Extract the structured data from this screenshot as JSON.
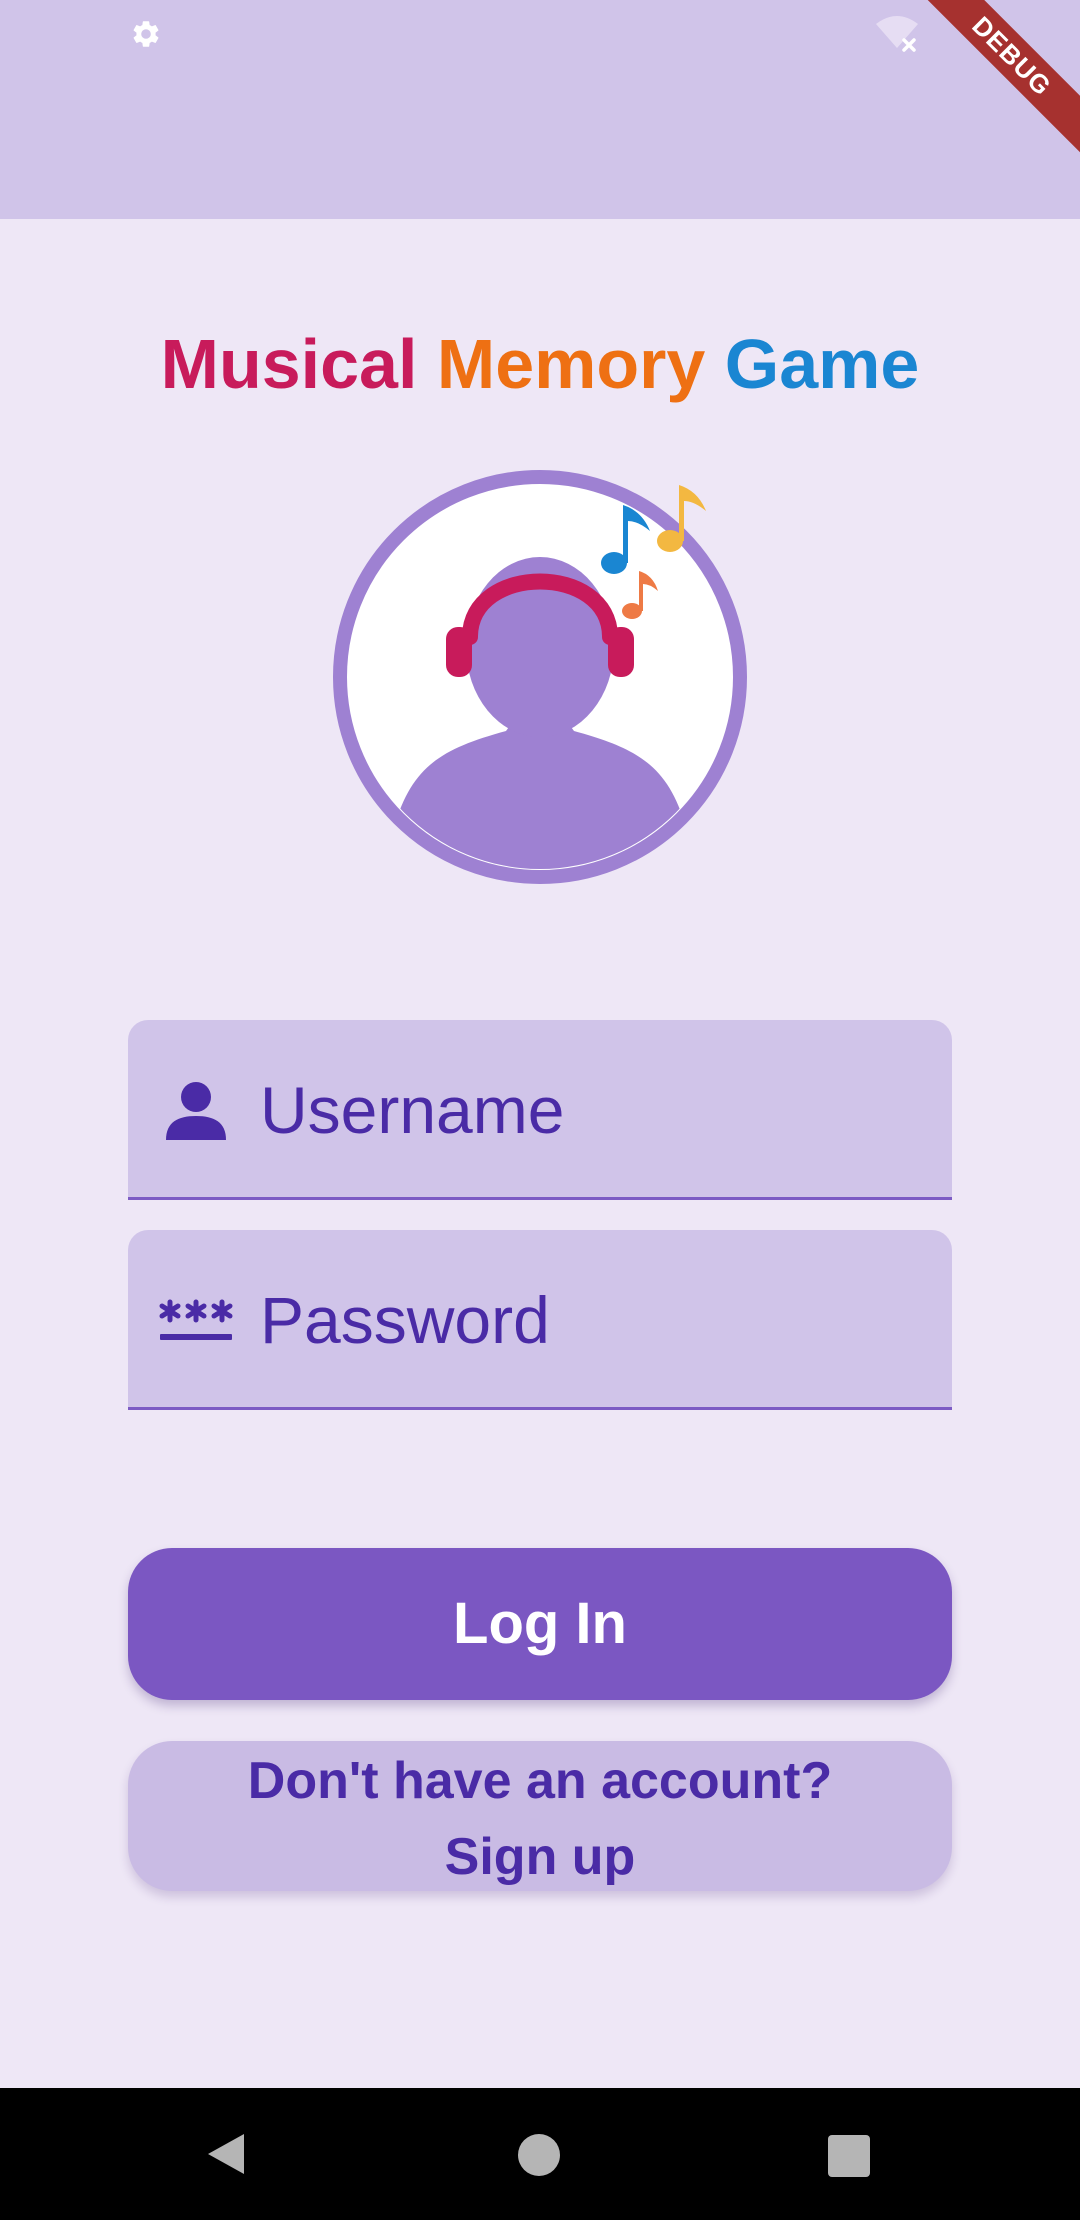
{
  "app": {
    "title_parts": [
      "Musical",
      "Memory",
      "Game"
    ]
  },
  "status_bar": {
    "left_icon": "gear-icon",
    "right_icon": "wifi-off-icon",
    "debug_label": "DEBUG"
  },
  "avatar": {
    "icon": "person-headphones-music-icon"
  },
  "form": {
    "username": {
      "icon": "person-icon",
      "placeholder": "Username",
      "value": ""
    },
    "password": {
      "icon": "password-icon",
      "placeholder": "Password",
      "value": ""
    }
  },
  "actions": {
    "login_label": "Log In",
    "signup_line1": "Don't have an account?",
    "signup_line2": "Sign up"
  },
  "nav_bar": {
    "back_icon": "back-triangle-icon",
    "home_icon": "home-circle-icon",
    "recents_icon": "recents-square-icon"
  },
  "colors": {
    "background": "#EEE7F6",
    "app_bar": "#D0C4E9",
    "primary": "#7B57C2",
    "primary_dark_text": "#4A2BA6",
    "title_musical": "#C81B5B",
    "title_memory": "#EE7013",
    "title_game": "#1A86D2",
    "debug_banner": "#A6312F"
  }
}
